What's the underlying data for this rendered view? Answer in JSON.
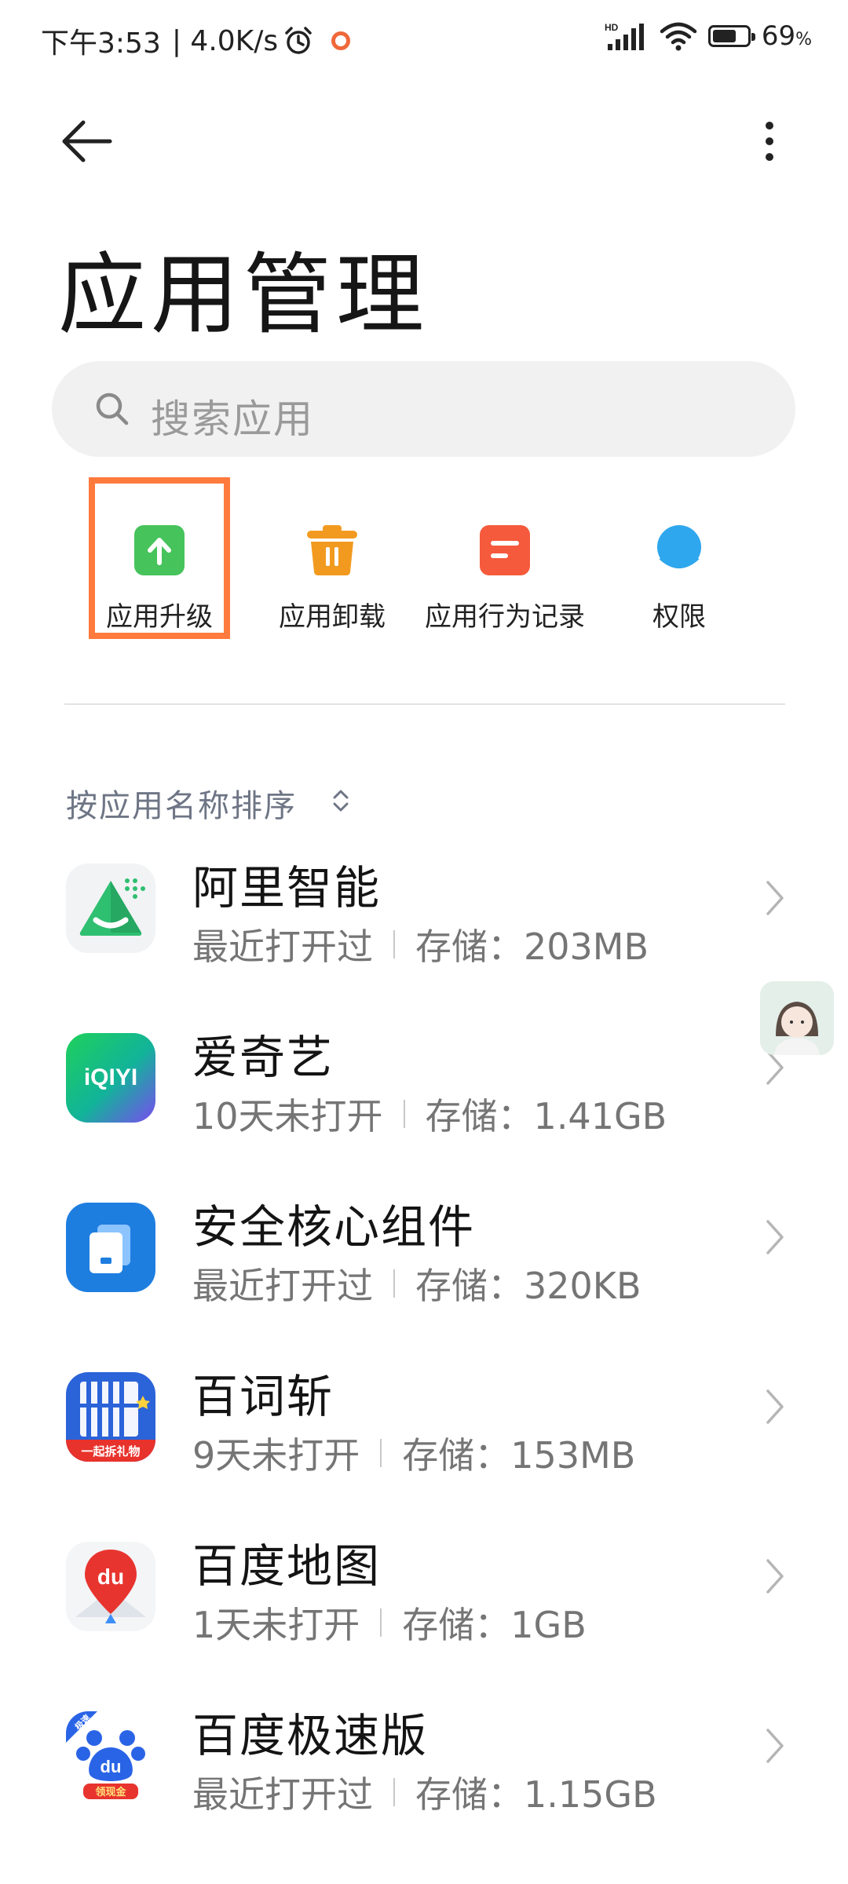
{
  "status_bar": {
    "time": "下午3:53",
    "net_speed": "| 4.0K/s",
    "network_badge": "HD",
    "battery_percent": 69,
    "battery_label": "69",
    "battery_unit": "%",
    "icons": [
      "alarm-icon",
      "recording-dot-icon",
      "signal-icon",
      "wifi-icon",
      "battery-icon"
    ]
  },
  "header": {
    "title": "应用管理",
    "icons": [
      "back-arrow-icon",
      "more-vertical-icon"
    ]
  },
  "search": {
    "placeholder": "搜索应用",
    "icon": "search-icon"
  },
  "shortcuts": [
    {
      "label": "应用升级",
      "icon": "app-upgrade-icon",
      "color": "#46c35b",
      "highlighted": true
    },
    {
      "label": "应用卸载",
      "icon": "uninstall-trash-icon",
      "color": "#f29a1f"
    },
    {
      "label": "应用行为记录",
      "icon": "behavior-record-icon",
      "color": "#f55a3c"
    },
    {
      "label": "权限",
      "icon": "permission-icon",
      "color": "#2ea7ee"
    }
  ],
  "highlight_color": "#ff7a3d",
  "sort": {
    "label": "按应用名称排序",
    "icon": "sort-toggle-icon"
  },
  "apps": [
    {
      "name": "阿里智能",
      "last_used": "最近打开过",
      "storage": "存储：203MB",
      "icon": "ali-smart-app-icon"
    },
    {
      "name": "爱奇艺",
      "last_used": "10天未打开",
      "storage": "存储：1.41GB",
      "icon": "iqiyi-app-icon",
      "icon_text": "iQIYI"
    },
    {
      "name": "安全核心组件",
      "last_used": "最近打开过",
      "storage": "存储：320KB",
      "icon": "security-core-app-icon"
    },
    {
      "name": "百词斩",
      "last_used": "9天未打开",
      "storage": "存储：153MB",
      "icon": "baicizhan-app-icon",
      "icon_text": "一起拆礼物"
    },
    {
      "name": "百度地图",
      "last_used": "1天未打开",
      "storage": "存储：1GB",
      "icon": "baidu-map-app-icon",
      "icon_text": "du"
    },
    {
      "name": "百度极速版",
      "last_used": "最近打开过",
      "storage": "存储：1.15GB",
      "icon": "baidu-lite-app-icon",
      "icon_text": "du",
      "icon_badge": "领现金",
      "icon_corner": "极速"
    }
  ]
}
